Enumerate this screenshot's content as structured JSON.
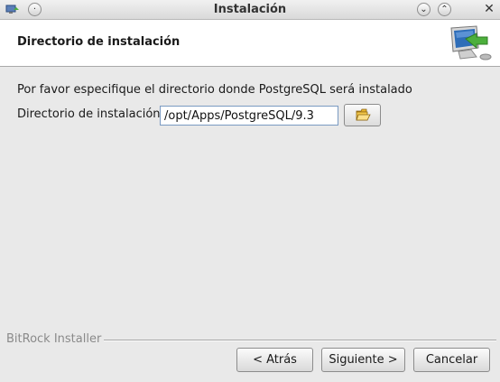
{
  "window": {
    "title": "Instalación",
    "icons": [
      "app-icon",
      "menu-icon",
      "minimize-icon",
      "maximize-icon",
      "close-icon"
    ]
  },
  "header": {
    "title": "Directorio de instalación",
    "icon": "install-computer-icon"
  },
  "main": {
    "description": "Por favor especifique el directorio donde PostgreSQL será instalado",
    "dir_label": "Directorio de instalación",
    "dir_value": "/opt/Apps/PostgreSQL/9.3",
    "browse_icon": "folder-open-icon"
  },
  "footer": {
    "brand": "BitRock Installer",
    "back_label": "< Atrás",
    "next_label": "Siguiente >",
    "cancel_label": "Cancelar"
  },
  "colors": {
    "background": "#e9e9e9",
    "header_bg": "#ffffff",
    "input_border": "#7a9ac2",
    "arrow_green": "#4caf3c"
  }
}
